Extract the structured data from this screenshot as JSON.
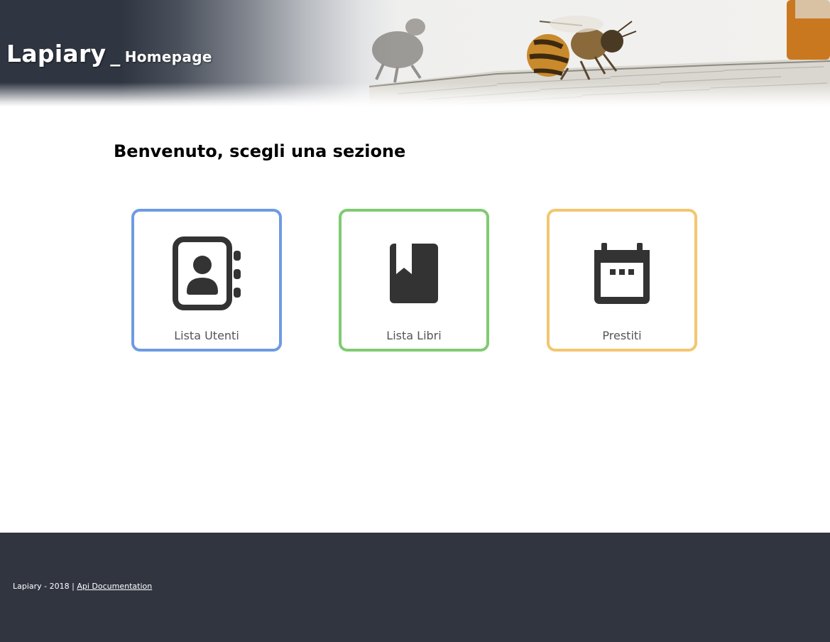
{
  "header": {
    "title": "Lapiary",
    "separator": "_",
    "subtitle": "Homepage"
  },
  "main": {
    "heading": "Benvenuto, scegli una sezione",
    "sections": [
      {
        "label": "Lista Utenti",
        "icon": "contacts-book-icon",
        "border_color": "#6e9be2"
      },
      {
        "label": "Lista Libri",
        "icon": "book-bookmark-icon",
        "border_color": "#80cb72"
      },
      {
        "label": "Prestiti",
        "icon": "calendar-icon",
        "border_color": "#f3c66f"
      }
    ]
  },
  "footer": {
    "text": "Lapiary - 2018 | ",
    "link_label": "Api Documentation"
  },
  "colors": {
    "header_dark": "#2f3541",
    "footer_bg": "#303540",
    "icon_color": "#333333"
  }
}
